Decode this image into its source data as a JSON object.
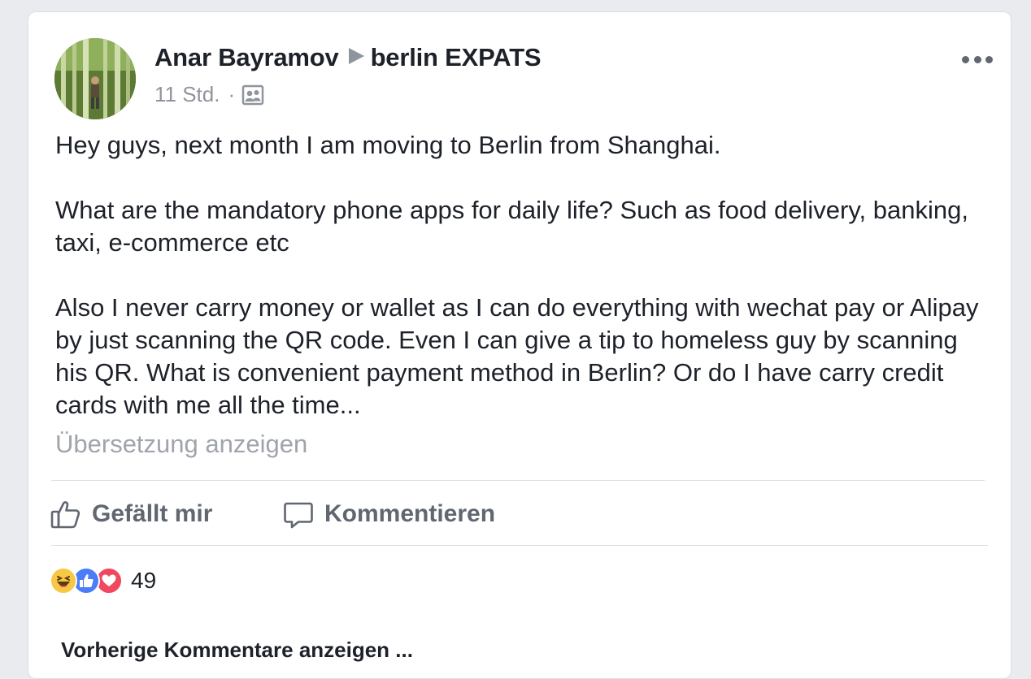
{
  "post": {
    "author": "Anar Bayramov",
    "group": "berlin EXPATS",
    "time": "11 Std.",
    "separator": "·",
    "audience_icon": "group-audience-icon",
    "body": [
      "Hey guys, next month I am moving to Berlin from Shanghai.",
      "What are the mandatory phone apps for daily life? Such as food delivery, banking, taxi, e-commerce etc",
      "Also I never carry money or wallet as I can do everything with wechat pay or Alipay by just scanning the QR code. Even I can give a tip to homeless guy by scanning his QR. What is convenient payment method in Berlin? Or do I have carry credit cards with me all the time..."
    ],
    "translate_link": "Übersetzung anzeigen"
  },
  "actions": {
    "like_label": "Gefällt mir",
    "comment_label": "Kommentieren"
  },
  "reactions": {
    "types": [
      "haha",
      "like",
      "love"
    ],
    "count": "49"
  },
  "comments": {
    "previous_label": "Vorherige Kommentare anzeigen ..."
  },
  "colors": {
    "text": "#1d2129",
    "secondary": "#90949c",
    "like_blue": "#4a7df7",
    "love_red": "#f0485f",
    "haha_yellow": "#f7c843"
  }
}
